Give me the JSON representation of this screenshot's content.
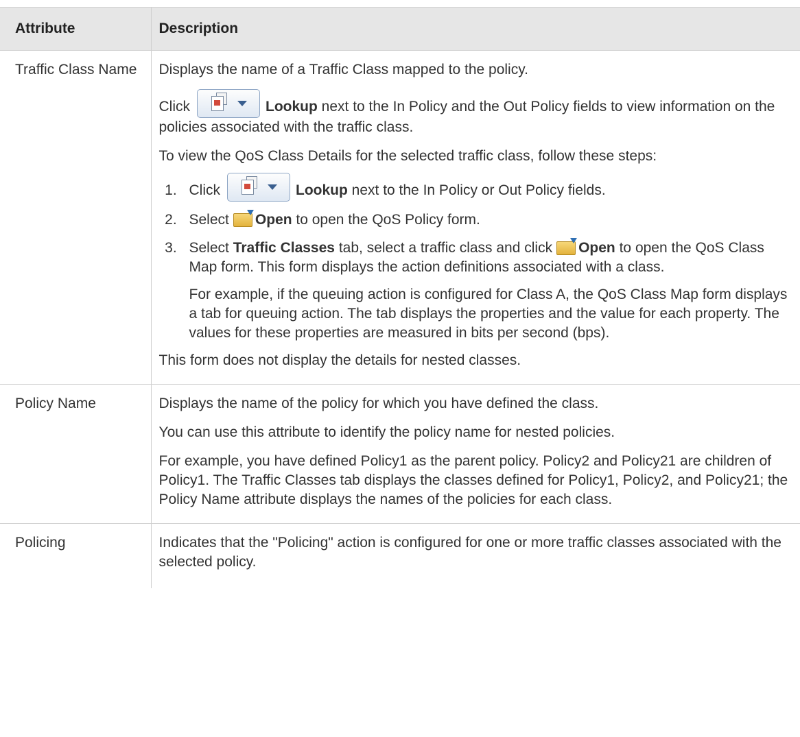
{
  "table": {
    "headers": {
      "attribute": "Attribute",
      "description": "Description"
    },
    "rows": [
      {
        "attribute": "Traffic Class Name",
        "intro": "Displays the name of a Traffic Class mapped to the policy.",
        "lookup_prefix": "Click",
        "lookup_label": "Lookup",
        "lookup_suffix": "next to the In Policy and the Out Policy fields to view information on the policies associated with the traffic class.",
        "steps_intro": "To view the QoS Class Details for the selected traffic class, follow these steps:",
        "steps": [
          {
            "prefix": "Click",
            "bold": "Lookup",
            "suffix": "next to the In Policy or Out Policy fields."
          },
          {
            "prefix": "Select",
            "bold": "Open",
            "suffix": "to open the QoS Policy form."
          },
          {
            "prefix": "Select",
            "bold": "Traffic Classes",
            "mid": "tab, select a traffic class and click",
            "bold2": "Open",
            "suffix": "to open the QoS Class Map form. This form displays the action definitions associated with a class.",
            "note": "For example, if the queuing action is configured for Class A, the QoS Class Map form displays a tab for queuing action. The tab displays the properties and the value for each property. The values for these properties are measured in bits per second (bps)."
          }
        ],
        "footer": "This form does not display the details for nested classes."
      },
      {
        "attribute": "Policy Name",
        "paragraphs": [
          "Displays the name of the policy for which you have defined the class.",
          "You can use this attribute to identify the policy name for nested policies.",
          "For example, you have defined Policy1 as the parent policy. Policy2 and Policy21 are children of Policy1. The Traffic Classes tab displays the classes defined for Policy1, Policy2, and Policy21; the Policy Name attribute displays the names of the policies for each class."
        ]
      },
      {
        "attribute": "Policing",
        "paragraphs": [
          "Indicates that the \"Policing\" action is configured for one or more traffic classes associated with the selected policy."
        ]
      }
    ]
  },
  "icons": {
    "lookup": "lookup-dropdown-icon",
    "open": "open-folder-icon"
  }
}
